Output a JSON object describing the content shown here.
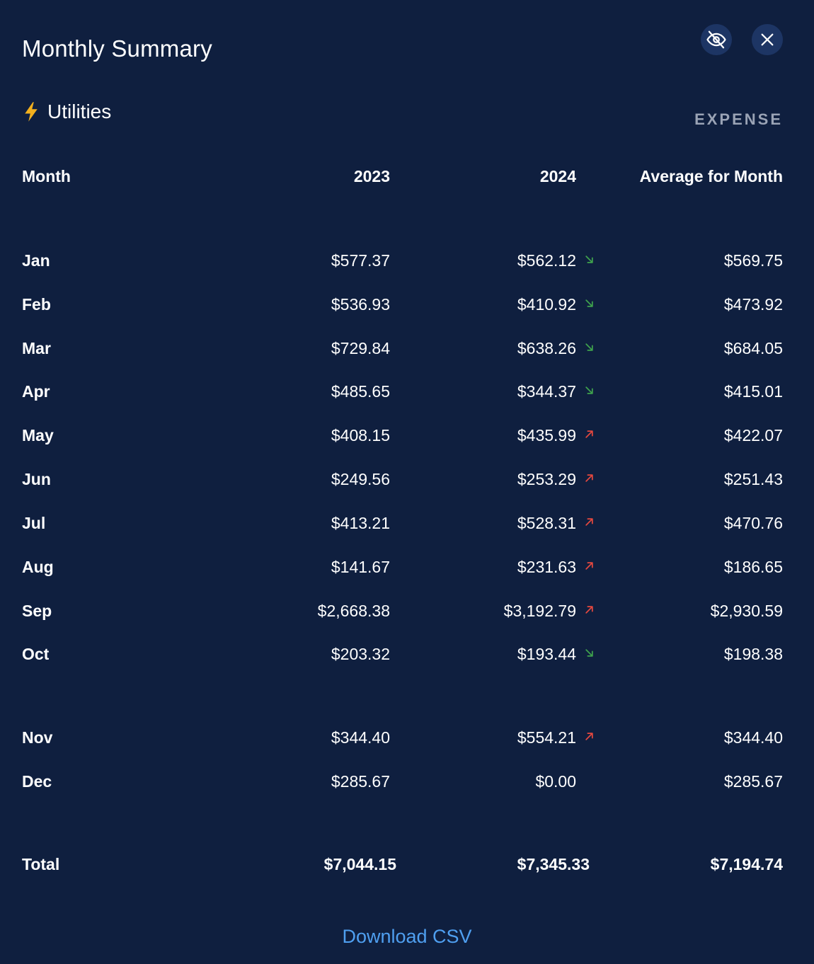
{
  "dialog": {
    "title": "Monthly Summary",
    "hide_icon": "eye-off-icon",
    "close_icon": "close-icon"
  },
  "category": {
    "icon": "lightning-bolt-icon",
    "name": "Utilities",
    "kind": "EXPENSE"
  },
  "table": {
    "headers": {
      "month": "Month",
      "year1": "2023",
      "year2": "2024",
      "average": "Average for Month"
    },
    "rows": [
      {
        "month": "Jan",
        "y2023": "$577.37",
        "y2024": "$562.12",
        "trend": "down",
        "avg": "$569.75"
      },
      {
        "month": "Feb",
        "y2023": "$536.93",
        "y2024": "$410.92",
        "trend": "down",
        "avg": "$473.92"
      },
      {
        "month": "Mar",
        "y2023": "$729.84",
        "y2024": "$638.26",
        "trend": "down",
        "avg": "$684.05"
      },
      {
        "month": "Apr",
        "y2023": "$485.65",
        "y2024": "$344.37",
        "trend": "down",
        "avg": "$415.01"
      },
      {
        "month": "May",
        "y2023": "$408.15",
        "y2024": "$435.99",
        "trend": "up",
        "avg": "$422.07"
      },
      {
        "month": "Jun",
        "y2023": "$249.56",
        "y2024": "$253.29",
        "trend": "up",
        "avg": "$251.43"
      },
      {
        "month": "Jul",
        "y2023": "$413.21",
        "y2024": "$528.31",
        "trend": "up",
        "avg": "$470.76"
      },
      {
        "month": "Aug",
        "y2023": "$141.67",
        "y2024": "$231.63",
        "trend": "up",
        "avg": "$186.65"
      },
      {
        "month": "Sep",
        "y2023": "$2,668.38",
        "y2024": "$3,192.79",
        "trend": "up",
        "avg": "$2,930.59"
      },
      {
        "month": "Oct",
        "y2023": "$203.32",
        "y2024": "$193.44",
        "trend": "down",
        "avg": "$198.38"
      },
      {
        "month": "Nov",
        "y2023": "$344.40",
        "y2024": "$554.21",
        "trend": "up",
        "avg": "$344.40"
      },
      {
        "month": "Dec",
        "y2023": "$285.67",
        "y2024": "$0.00",
        "trend": "none",
        "avg": "$285.67"
      }
    ],
    "total": {
      "label": "Total",
      "y2023": "$7,044.15",
      "y2024": "$7,345.33",
      "avg": "$7,194.74"
    }
  },
  "actions": {
    "download_label": "Download CSV"
  },
  "colors": {
    "background": "#0f1f3f",
    "trend_down": "#3fa34d",
    "trend_up": "#e5483f",
    "link": "#4f9ff0",
    "muted": "#9aa3b5"
  }
}
